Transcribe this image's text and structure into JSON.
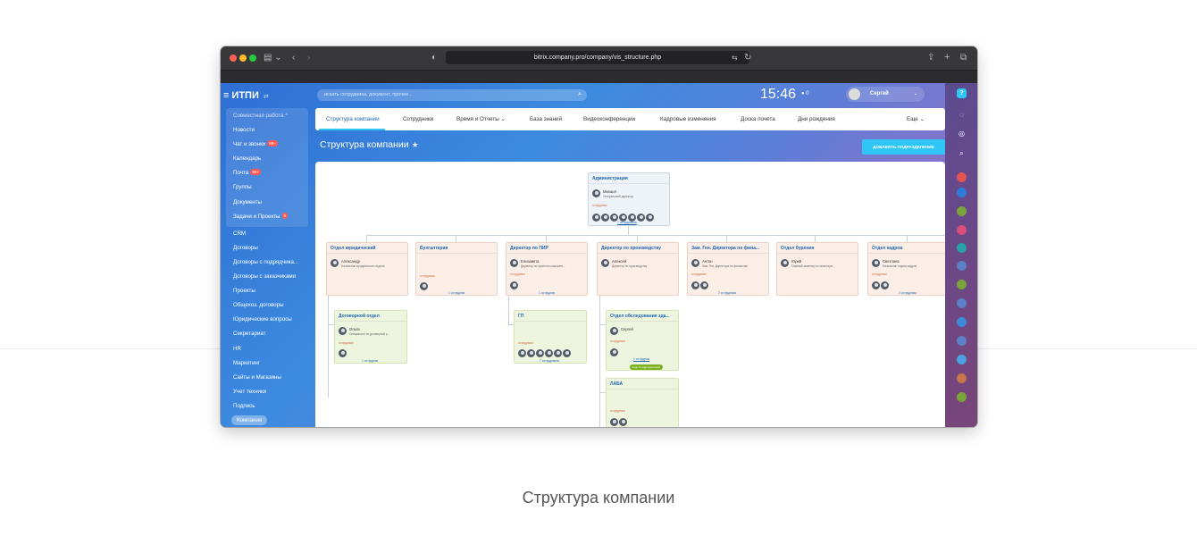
{
  "browser": {
    "url": "bitrix.company.pro/company/vis_structure.php"
  },
  "app": {
    "logo": "ИТПИ"
  },
  "sidebar": {
    "items": [
      {
        "label": "Совместная работа ^",
        "head": true
      },
      {
        "label": "Новости"
      },
      {
        "label": "Чат и звонки",
        "badge": "99+"
      },
      {
        "label": "Календарь"
      },
      {
        "label": "Почта",
        "badge": "99+"
      },
      {
        "label": "Группы"
      },
      {
        "label": "Документы"
      },
      {
        "label": "Задачи и Проекты",
        "badge": "6"
      },
      {
        "label": "CRM"
      },
      {
        "label": "Договоры"
      },
      {
        "label": "Договоры с подрядчика..."
      },
      {
        "label": "Договоры с заказчиками"
      },
      {
        "label": "Проекты"
      },
      {
        "label": "Общехоз. договоры"
      },
      {
        "label": "Юридические вопросы"
      },
      {
        "label": "Секретариат"
      },
      {
        "label": "HR"
      },
      {
        "label": "Маркетинг"
      },
      {
        "label": "Сайты и Магазины"
      },
      {
        "label": "Учет техники"
      },
      {
        "label": "Подпись"
      },
      {
        "label": "Компания",
        "active": true
      }
    ]
  },
  "header": {
    "search_placeholder": "искать сотрудника, документ, прочее...",
    "clock": "15:46",
    "notif": "0",
    "user": "Сергей"
  },
  "nav": {
    "tabs": [
      "Структура компании",
      "Сотрудники",
      "Время и Отчеты ⌄",
      "База знаний",
      "Видеоконференции",
      "Кадровые изменения",
      "Доска почета",
      "Дни рождения",
      "Еще ⌄"
    ]
  },
  "page": {
    "title": "Структура компании",
    "add_button": "ДОБАВИТЬ ПОДРАЗДЕЛЕНИЕ"
  },
  "org": {
    "admin": {
      "title": "Администрация",
      "head": "Михаил",
      "position": "Генеральный директор",
      "emp_label": "сотрудники",
      "link": "7 сотрудников"
    },
    "departments": [
      {
        "title": "Отдел юридический",
        "head": "Александр",
        "position": "Начальник юридического отдела"
      },
      {
        "title": "Бухгалтерия",
        "emp_label": "сотрудники",
        "link": "1 сотрудник"
      },
      {
        "title": "Директор по ПИР",
        "head": "Елизавета",
        "position": "Директор по проектно-изыскате...",
        "emp_label": "сотрудники",
        "link": "1 сотрудник"
      },
      {
        "title": "Директор по производству",
        "head": "Алексей",
        "position": "Директор по производству"
      },
      {
        "title": "Зам. Ген. Директора по фина...",
        "head": "Антон",
        "position": "Зам. Ген. Директора по финансам",
        "emp_label": "сотрудники",
        "link": "2 сотрудника"
      },
      {
        "title": "Отдел бурения",
        "head": "Юрий",
        "position": "Главный инженер по инженерн..."
      },
      {
        "title": "Отдел кадров",
        "head": "Светлана",
        "position": "Начальник отдела кадров",
        "emp_label": "сотрудники",
        "link": "2 сотрудника"
      }
    ],
    "subs": [
      {
        "title": "Договорной отдел",
        "head": "Ольга",
        "position": "Специалист по договорной р...",
        "emp_label": "сотрудники",
        "link": "1 сотрудник"
      },
      {
        "title": "ГП",
        "emp_label": "сотрудники",
        "link": "7 сотрудников"
      },
      {
        "title": "Отдел обследования зда...",
        "head": "Сергей",
        "emp_label": "сотрудники",
        "link": "1 сотрудник",
        "badge": "Еще 6 подразделений"
      },
      {
        "title": "ЛАБА",
        "emp_label": "сотрудники"
      }
    ]
  },
  "caption": "Структура компании",
  "colors": {
    "accent": "#2fc6f6",
    "link": "#2067b0",
    "badge": "#ff5752",
    "dept_bg": "#fbeee7",
    "sub_bg": "#eef5de",
    "admin_bg": "#eef3f8"
  }
}
